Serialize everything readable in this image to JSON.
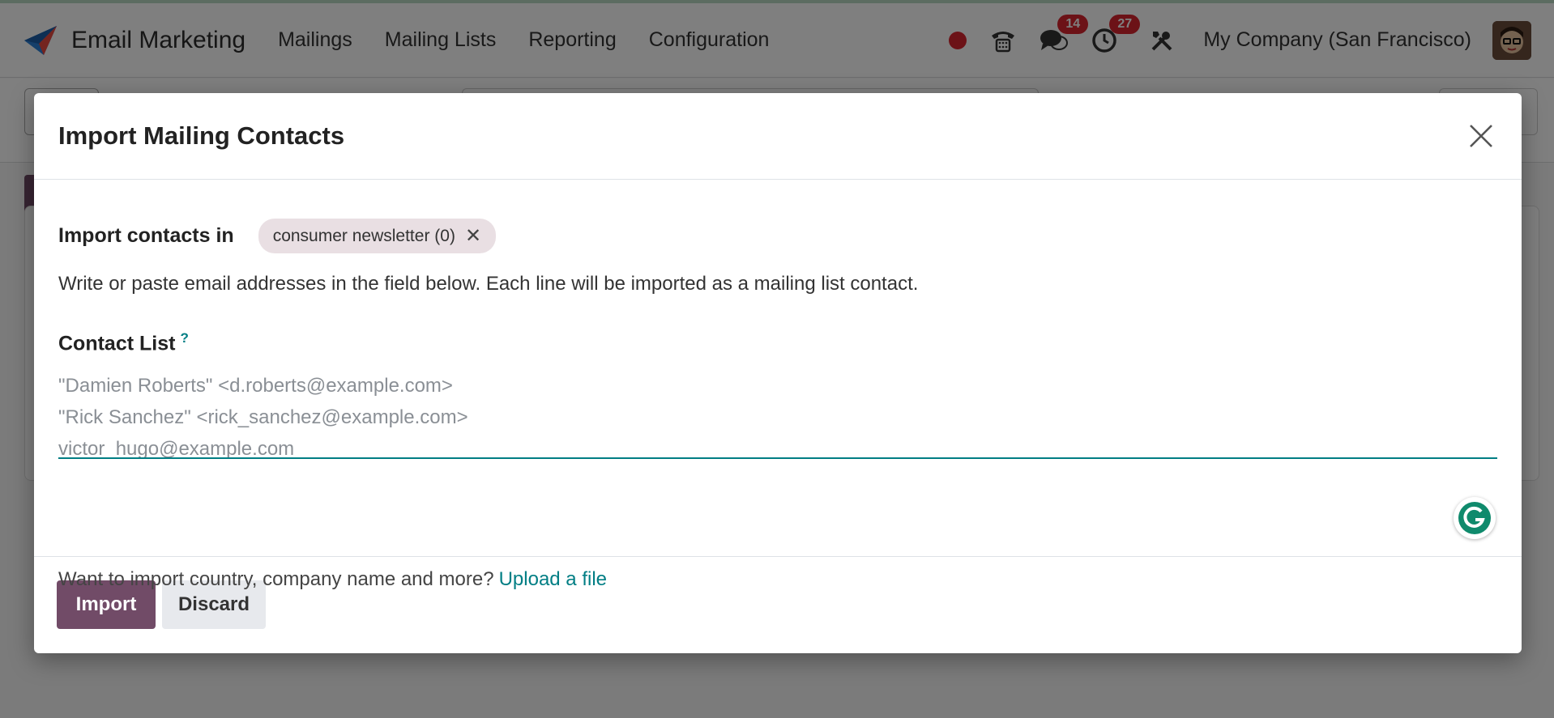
{
  "app": {
    "name": "Email Marketing",
    "icon": "email-marketing-app-icon"
  },
  "menu": {
    "items": [
      {
        "label": "Mailings"
      },
      {
        "label": "Mailing Lists"
      },
      {
        "label": "Reporting"
      },
      {
        "label": "Configuration"
      }
    ]
  },
  "systray": {
    "recording_color": "#d9242f",
    "messages_count": "14",
    "activities_count": "27",
    "company": "My Company (San Francisco)"
  },
  "modal": {
    "title": "Import Mailing Contacts",
    "import_label": "Import contacts in",
    "list_tag": "consumer newsletter (0)",
    "help_text": "Write or paste email addresses in the field below. Each line will be imported as a mailing list contact.",
    "contact_list_label": "Contact List",
    "contact_list_help": "?",
    "contact_list_value": "",
    "contact_list_placeholder": "\"Damien Roberts\" <d.roberts@example.com>\n\"Rick Sanchez\" <rick_sanchez@example.com>\nvictor_hugo@example.com",
    "upload_prompt": "Want to import country, company name and more?",
    "upload_link": "Upload a file",
    "import_button": "Import",
    "discard_button": "Discard"
  },
  "colors": {
    "primary": "#714b67",
    "accent": "#017e84",
    "badge": "#d9242f"
  }
}
